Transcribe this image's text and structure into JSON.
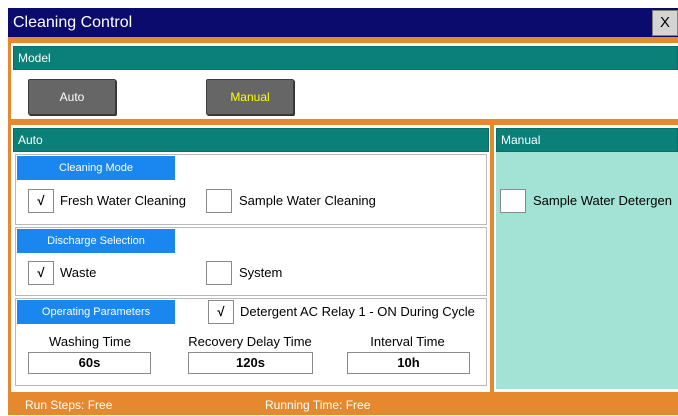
{
  "window": {
    "title": "Cleaning Control",
    "close_label": "X"
  },
  "model": {
    "header": "Model",
    "auto_button": "Auto",
    "manual_button": "Manual"
  },
  "auto": {
    "header": "Auto",
    "cleaning_mode": {
      "label": "Cleaning Mode",
      "fresh": {
        "label": "Fresh Water Cleaning",
        "mark": "√"
      },
      "sample": {
        "label": "Sample Water Cleaning",
        "mark": ""
      }
    },
    "discharge": {
      "label": "Discharge Selection",
      "waste": {
        "label": "Waste",
        "mark": "√"
      },
      "system": {
        "label": "System",
        "mark": ""
      }
    },
    "operating": {
      "label": "Operating Parameters",
      "relay": {
        "label": "Detergent AC Relay 1 - ON During Cycle",
        "mark": "√"
      },
      "washing_label": "Washing Time",
      "washing_value": "60s",
      "recovery_label": "Recovery Delay Time",
      "recovery_value": "120s",
      "interval_label": "Interval Time",
      "interval_value": "10h"
    }
  },
  "manual": {
    "header": "Manual",
    "detergent": {
      "label": "Sample Water Detergen",
      "mark": ""
    }
  },
  "status": {
    "run_steps": "Run Steps: Free",
    "running_time": "Running Time: Free"
  },
  "colors": {
    "title_bar": "#0b0b6e",
    "teal_header": "#0a8078",
    "blue_label": "#1a86f0",
    "frame_orange": "#e6892e",
    "manual_panel": "#a3e3d5",
    "manual_button_text": "#ffff00"
  }
}
